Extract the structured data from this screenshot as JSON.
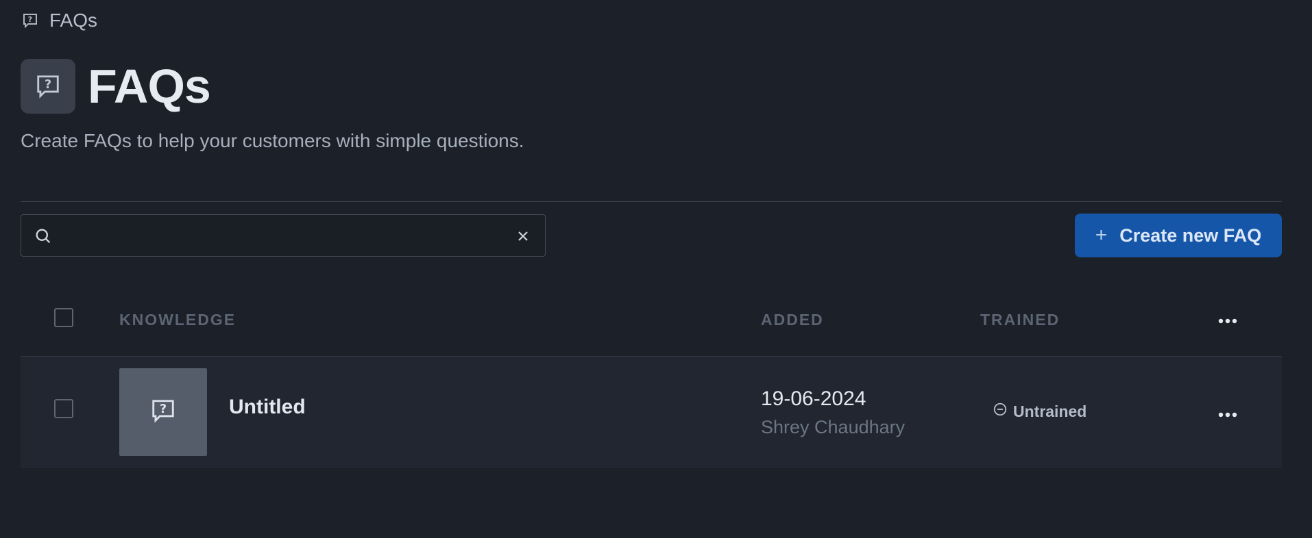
{
  "breadcrumb": {
    "label": "FAQs",
    "icon": "faq-bubble-icon"
  },
  "header": {
    "title": "FAQs",
    "subtitle": "Create FAQs to help your customers with simple questions.",
    "icon": "faq-bubble-icon"
  },
  "search": {
    "value": "",
    "placeholder": "",
    "icons": [
      "search-icon",
      "close-icon"
    ]
  },
  "toolbar": {
    "create_label": "Create new FAQ",
    "create_icon": "+",
    "accent": "#1556a8"
  },
  "table": {
    "columns": {
      "knowledge": "KNOWLEDGE",
      "added": "ADDED",
      "trained": "TRAINED"
    },
    "rows": [
      {
        "title": "Untitled",
        "date": "19-06-2024",
        "author": "Shrey Chaudhary",
        "status": "Untrained",
        "status_icon": "minus-circle-icon"
      }
    ]
  },
  "colors": {
    "background": "#1c2028",
    "row_background": "#212630",
    "button": "#1556a8"
  }
}
